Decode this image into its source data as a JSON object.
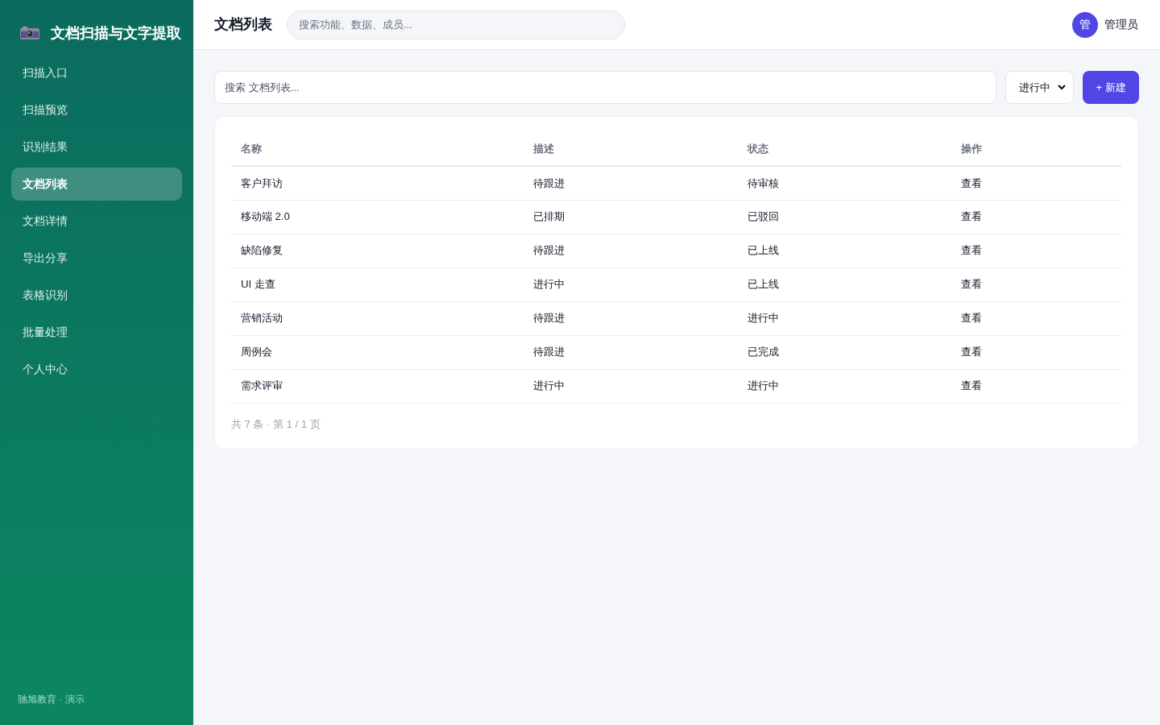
{
  "sidebar": {
    "logo": "文档扫描与文字提取",
    "items": [
      {
        "label": "扫描入口",
        "selected": false
      },
      {
        "label": "扫描预览",
        "selected": false
      },
      {
        "label": "识别结果",
        "selected": false
      },
      {
        "label": "文档列表",
        "selected": true
      },
      {
        "label": "文档详情",
        "selected": false
      },
      {
        "label": "导出分享",
        "selected": false
      },
      {
        "label": "表格识别",
        "selected": false
      },
      {
        "label": "批量处理",
        "selected": false
      },
      {
        "label": "个人中心",
        "selected": false
      }
    ],
    "footer": "驰旭教育 · 演示"
  },
  "header": {
    "title": "文档列表",
    "search": {
      "placeholder": "搜索功能、数据、成员..."
    },
    "user": {
      "avatar": "管",
      "name": "管理员"
    }
  },
  "toolbar": {
    "search": {
      "placeholder": "搜索 文档列表..."
    },
    "filter": "进行中",
    "new_button": "+ 新建"
  },
  "table": {
    "columns": [
      "名称",
      "描述",
      "状态",
      "操作"
    ],
    "rows": [
      {
        "name": "客户拜访",
        "description": "待跟进",
        "status": "待审核",
        "action": "查看"
      },
      {
        "name": "移动端 2.0",
        "description": "已排期",
        "status": "已驳回",
        "action": "查看"
      },
      {
        "name": "缺陷修复",
        "description": "待跟进",
        "status": "已上线",
        "action": "查看"
      },
      {
        "name": "UI 走查",
        "description": "进行中",
        "status": "已上线",
        "action": "查看"
      },
      {
        "name": "营销活动",
        "description": "待跟进",
        "status": "进行中",
        "action": "查看"
      },
      {
        "name": "周例会",
        "description": "待跟进",
        "status": "已完成",
        "action": "查看"
      },
      {
        "name": "需求评审",
        "description": "进行中",
        "status": "进行中",
        "action": "查看"
      }
    ],
    "pagination": "共 7 条 · 第 1 / 1 页"
  }
}
